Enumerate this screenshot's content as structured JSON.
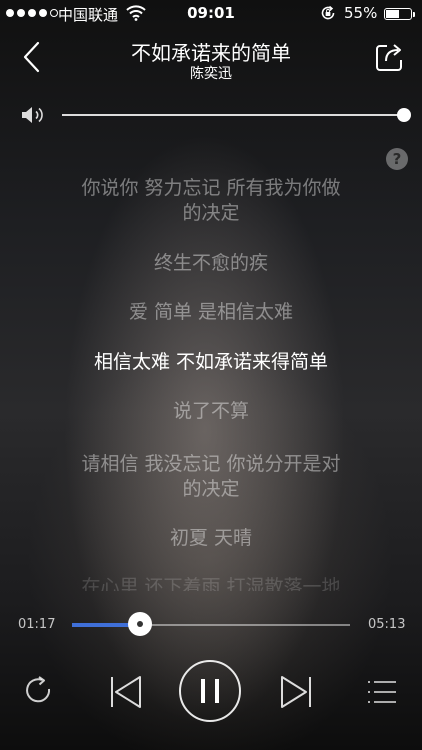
{
  "status_bar": {
    "carrier": "中国联通",
    "time": "09:01",
    "battery_percent": "55%",
    "battery_level": 0.55,
    "signal_bars": 4,
    "signal_max": 5
  },
  "header": {
    "song_title": "不如承诺来的简单",
    "artist": "陈奕迅"
  },
  "volume": {
    "level": 1.0
  },
  "help_label": "?",
  "lyrics": [
    {
      "text": "你说你  努力忘记  所有我为你做\n的决定",
      "state": "past"
    },
    {
      "text": "终生不愈的疾",
      "state": "past"
    },
    {
      "text": "爱  简单  是相信太难",
      "state": "past"
    },
    {
      "text": "相信太难  不如承诺来得简单",
      "state": "current"
    },
    {
      "text": "说了不算",
      "state": "upcoming"
    },
    {
      "text": "请相信  我没忘记  你说分开是对\n的决定",
      "state": "upcoming"
    },
    {
      "text": "初夏  天晴",
      "state": "upcoming"
    },
    {
      "text": "在心里  还下着雨  打湿散落一地",
      "state": "fade"
    }
  ],
  "progress": {
    "elapsed": "01:17",
    "total": "05:13",
    "fraction": 0.246
  },
  "accent_color": "#3f6fd8",
  "icons": {
    "back": "chevron-left-icon",
    "share": "share-icon",
    "volume": "speaker-icon",
    "repeat": "repeat-icon",
    "prev": "skip-previous-icon",
    "play": "pause-icon",
    "next": "skip-next-icon",
    "playlist": "playlist-icon"
  }
}
